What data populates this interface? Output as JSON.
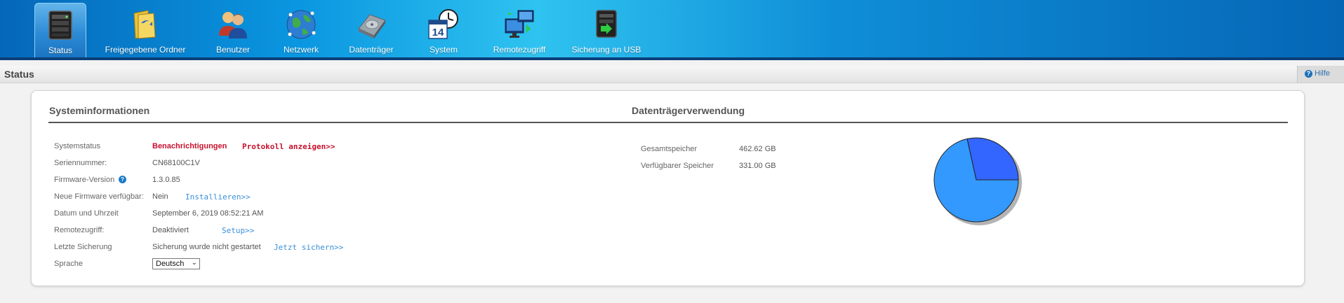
{
  "nav": {
    "items": [
      {
        "label": "Status",
        "icon": "nas-device-icon",
        "active": true
      },
      {
        "label": "Freigegebene Ordner",
        "icon": "shared-folder-icon"
      },
      {
        "label": "Benutzer",
        "icon": "users-icon"
      },
      {
        "label": "Netzwerk",
        "icon": "network-globe-icon"
      },
      {
        "label": "Datenträger",
        "icon": "hard-drive-icon"
      },
      {
        "label": "System",
        "icon": "calendar-clock-icon",
        "calendar_day": "14"
      },
      {
        "label": "Remotezugriff",
        "icon": "remote-access-icon"
      },
      {
        "label": "Sicherung an USB",
        "icon": "usb-backup-icon"
      }
    ]
  },
  "header": {
    "title": "Status",
    "help_label": "Hilfe",
    "help_icon_glyph": "?"
  },
  "system_info": {
    "title": "Systeminformationen",
    "info_glyph": "?",
    "rows": {
      "status": {
        "label": "Systemstatus",
        "value": "Benachrichtigungen",
        "link": "Protokoll anzeigen>>"
      },
      "serial": {
        "label": "Seriennummer:",
        "value": "CN68100C1V"
      },
      "firmware": {
        "label": "Firmware-Version",
        "value": "1.3.0.85"
      },
      "new_firmware": {
        "label": "Neue Firmware verfügbar:",
        "value": "Nein",
        "link": "Installieren>>"
      },
      "datetime": {
        "label": "Datum und Uhrzeit",
        "value": "September 6, 2019 08:52:21 AM"
      },
      "remote": {
        "label": "Remotezugriff:",
        "value": "Deaktiviert",
        "link": "Setup>>"
      },
      "backup": {
        "label": "Letzte Sicherung",
        "value": "Sicherung wurde nicht gestartet",
        "link": "Jetzt sichern>>"
      },
      "language": {
        "label": "Sprache",
        "selected": "Deutsch"
      }
    }
  },
  "disk_usage": {
    "title": "Datenträgerverwendung",
    "rows": {
      "total": {
        "label": "Gesamtspeicher",
        "value": "462.62 GB"
      },
      "available": {
        "label": "Verfügbarer Speicher",
        "value": "331.00 GB"
      }
    },
    "chart": {
      "used_gb": 131.62,
      "free_gb": 331.0,
      "colors": {
        "used": "#3366ff",
        "free": "#3399ff"
      }
    }
  },
  "colors": {
    "alert": "#c8102e",
    "link": "#3a8fd9",
    "nav_text": "#ffffff"
  }
}
